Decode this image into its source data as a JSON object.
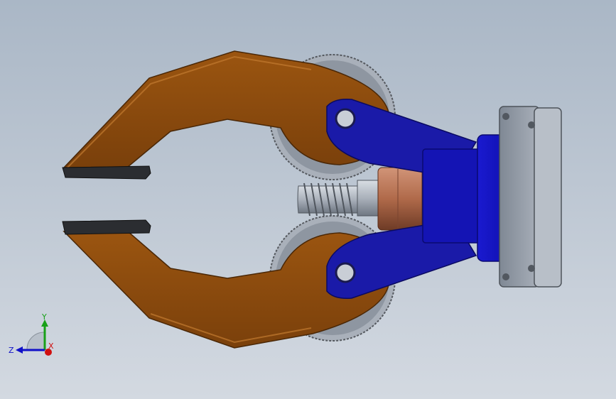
{
  "viewport": {
    "colors": {
      "background_top": "#aab7c6",
      "background_bottom": "#d3d9e1",
      "jaw": "#8a4a0c",
      "jaw_dark": "#5e3208",
      "jaw_light": "#b0671e",
      "link": "#1a1aa8",
      "link_light": "#2f2fe0",
      "housing": "#1212b8",
      "flange": "#8d96a3",
      "gear": "#a7aeb8",
      "worm": "#9aa1ab",
      "bushing": "#b36a4a",
      "pad": "#2b2d31"
    }
  },
  "model": {
    "parts": [
      "upper-jaw",
      "lower-jaw",
      "upper-gear",
      "lower-gear",
      "upper-link",
      "lower-link",
      "worm-screw",
      "bushing",
      "motor-housing",
      "mounting-flange",
      "upper-pad",
      "lower-pad"
    ]
  },
  "triad": {
    "x_label": "X",
    "y_label": "Y",
    "z_label": "Z",
    "x_color": "#d01010",
    "y_color": "#18a018",
    "z_color": "#1010c8"
  }
}
